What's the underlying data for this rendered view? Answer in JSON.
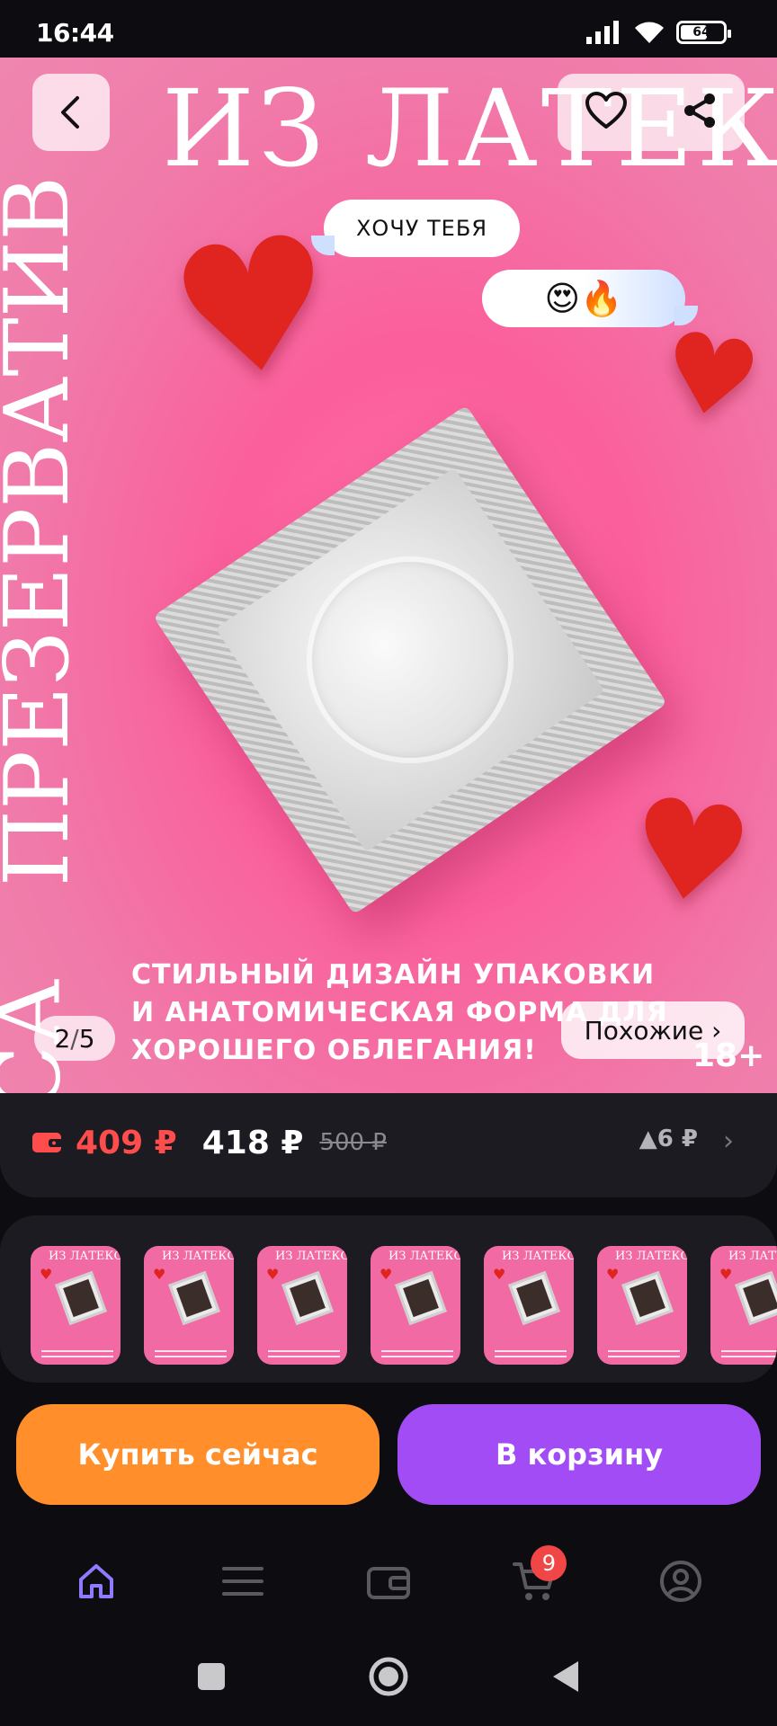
{
  "status_bar": {
    "time": "16:44",
    "battery": "64",
    "battery_level": 0.64
  },
  "hero": {
    "title": "ИЗ ЛАТЕКСА",
    "vertical_text": "ПРЕЗЕРВАТИВ",
    "vertical_text_2": "КСА",
    "bubble_1": "ХОЧУ ТЕБЯ",
    "bubble_2": "😍🔥",
    "caption_line_1": "СТИЛЬНЫЙ ДИЗАЙН УПАКОВКИ",
    "caption_line_2": "И АНАТОМИЧЕСКАЯ ФОРМА ДЛЯ",
    "caption_line_3": "ХОРОШЕГО ОБЛЕГАНИЯ!",
    "age": "18+",
    "page_current": "2",
    "page_total": "5",
    "similar_label": "Похожие ›"
  },
  "icons": {
    "back": "chevron-left-icon",
    "favorite": "heart-outline-icon",
    "share": "share-icon",
    "wallet": "wallet-icon",
    "home": "home-icon",
    "catalog": "menu-icon",
    "wallet_tab": "wallet-tab-icon",
    "cart": "cart-icon",
    "profile": "profile-icon"
  },
  "price": {
    "wallet_price": "409 ₽",
    "main_price": "418 ₽",
    "old_price": "500 ₽",
    "diff": "▲6 ₽",
    "chevron": "›"
  },
  "variants": {
    "count": 7,
    "thumb_title": "ИЗ ЛАТЕКСА"
  },
  "actions": {
    "buy_now": "Купить сейчас",
    "add_to_cart": "В корзину"
  },
  "tabbar": {
    "cart_badge": "9"
  },
  "colors": {
    "hero_pink": "#fb5f9c",
    "wallet_red": "#ff4d4d",
    "buy_orange": "#ff8e2b",
    "cart_purple": "#a24cf5",
    "active_tab": "#8e7bff",
    "badge_red": "#f04646"
  }
}
